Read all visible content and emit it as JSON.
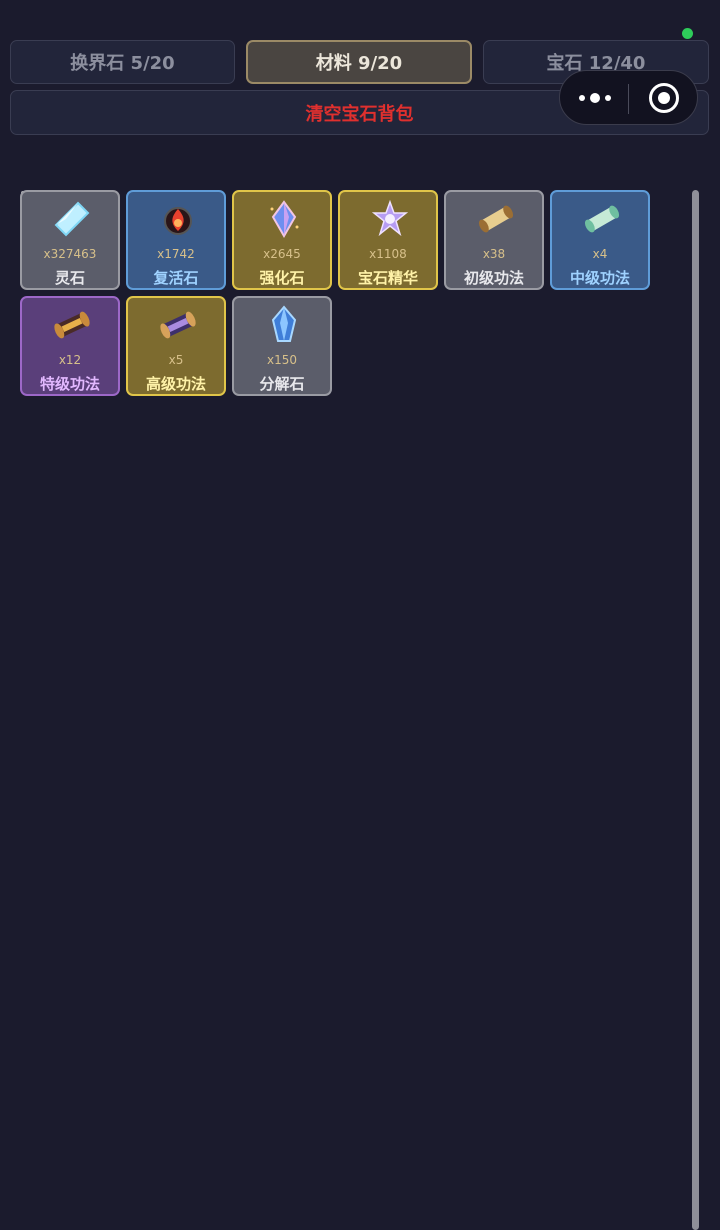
{
  "tabs": [
    {
      "label": "换界石 5/20",
      "active": false
    },
    {
      "label": "材料 9/20",
      "active": true
    },
    {
      "label": "宝石 12/40",
      "active": false
    }
  ],
  "clear_button": {
    "label": "清空宝石背包",
    "color": "#e0302e"
  },
  "capsule": {
    "more_icon": "more-icon",
    "close_icon": "record-icon"
  },
  "items": [
    {
      "name": "灵石",
      "count": "x327463",
      "quality": "gray",
      "icon": "crystal-icon"
    },
    {
      "name": "复活石",
      "count": "x1742",
      "quality": "blue",
      "icon": "revive-stone-icon"
    },
    {
      "name": "强化石",
      "count": "x2645",
      "quality": "gold",
      "icon": "enhance-stone-icon"
    },
    {
      "name": "宝石精华",
      "count": "x1108",
      "quality": "gold",
      "icon": "gem-essence-icon"
    },
    {
      "name": "初级功法",
      "count": "x38",
      "quality": "gray",
      "icon": "scroll-icon"
    },
    {
      "name": "中级功法",
      "count": "x4",
      "quality": "blue",
      "icon": "scroll-icon"
    },
    {
      "name": "特级功法",
      "count": "x12",
      "quality": "purple",
      "icon": "scroll-icon"
    },
    {
      "name": "高级功法",
      "count": "x5",
      "quality": "gold",
      "icon": "scroll-icon"
    },
    {
      "name": "分解石",
      "count": "x150",
      "quality": "gray",
      "icon": "decompose-stone-icon"
    }
  ],
  "colors": {
    "background": "#1b1b2d",
    "gray": "#5b5d6a",
    "blue": "#3a5a88",
    "gold": "#7d6b2f",
    "purple": "#5a3f7a"
  }
}
